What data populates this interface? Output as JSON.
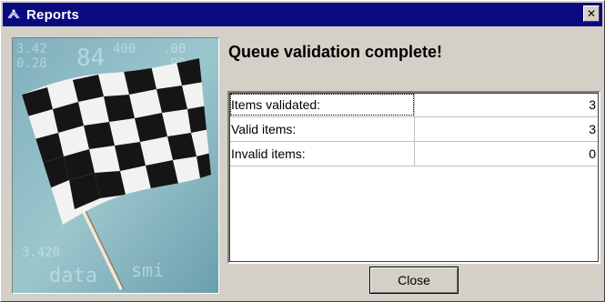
{
  "window": {
    "title": "Reports",
    "title_icon": "reports-app-icon",
    "close_icon": "close-x-icon",
    "close_glyph": "✕"
  },
  "picture": {
    "subject": "checkered-flag-image"
  },
  "heading": "Queue validation complete!",
  "results": {
    "rows": [
      {
        "label": "Items validated:",
        "value": "3"
      },
      {
        "label": "Valid items:",
        "value": "3"
      },
      {
        "label": "Invalid items:",
        "value": "0"
      }
    ]
  },
  "buttons": {
    "close_label": "Close"
  },
  "colors": {
    "titlebar": "#0a0a80",
    "face": "#d4d0c8"
  }
}
